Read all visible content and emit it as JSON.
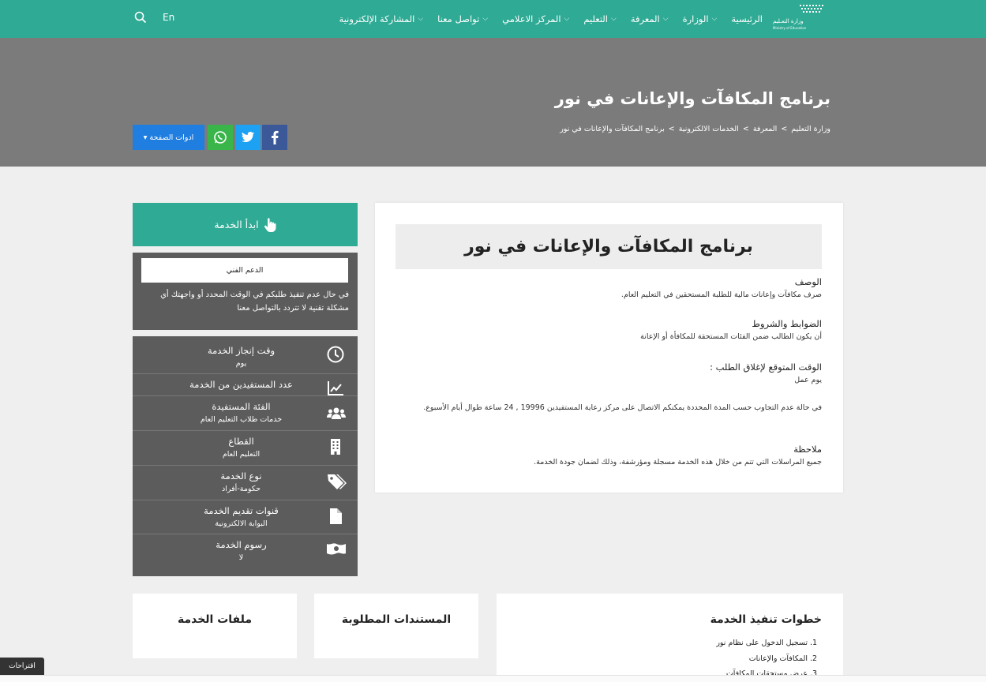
{
  "nav": {
    "menu": [
      {
        "label": "الرئيسية",
        "chevron": false
      },
      {
        "label": "الوزارة",
        "chevron": true
      },
      {
        "label": "المعرفة",
        "chevron": true
      },
      {
        "label": "التعليم",
        "chevron": true
      },
      {
        "label": "المركز الاعلامي",
        "chevron": true
      },
      {
        "label": "تواصل معنا",
        "chevron": true
      },
      {
        "label": "المشاركة الإلكترونية",
        "chevron": true
      }
    ],
    "lang_label": "En",
    "logo_text": "وزارة التعـليم",
    "logo_subtext": "Ministry of Education",
    "chevron_glyph": "⌵"
  },
  "hero": {
    "title": "برنامج المكافآت والإعانات في نور",
    "breadcrumb": [
      "وزارة التعليم",
      "المعرفة",
      "الخدمات الالكترونية",
      "برنامج المكافآت والإعانات في نور"
    ],
    "breadcrumb_sep": ">",
    "tools_label": "ادوات الصفحة",
    "tools_caret": "▾"
  },
  "sidebar": {
    "start_label": "ابدأ الخدمة",
    "support": {
      "button_label": "الدعم الفني",
      "text": "في حال عدم تنفيذ طلبكم في الوقت المحدد أو واجهتك أي مشكلة تقنية لا تتردد بالتواصل معنا"
    },
    "info": [
      {
        "label": "وقت إنجاز الخدمة",
        "value": "يوم",
        "icon": "clock-icon"
      },
      {
        "label": "عدد المستفيدين من الخدمة",
        "value": "",
        "icon": "chart-icon"
      },
      {
        "label": "الفئة المستفيدة",
        "value": "خدمات طلاب التعليم العام",
        "icon": "users-icon"
      },
      {
        "label": "القطاع",
        "value": "التعليم العام",
        "icon": "building-icon"
      },
      {
        "label": "نوع الخدمة",
        "value": "حكومة-أفراد",
        "icon": "tags-icon"
      },
      {
        "label": "قنوات تقديم الخدمة",
        "value": "البوابة الالكترونية",
        "icon": "file-icon"
      },
      {
        "label": "رسوم الخدمة",
        "value": "لا",
        "icon": "money-icon"
      }
    ]
  },
  "content": {
    "title": "برنامج المكافآت والإعانات في نور",
    "sections": [
      {
        "heading": "الوصف",
        "body": "صرف مكافآت وإعانات مالية للطلبة المستحقين في التعليم العام."
      },
      {
        "heading": "الضوابط والشروط",
        "body": "أن يكون الطالب ضمن الفئات المستحقة للمكافأة أو الإعانة"
      },
      {
        "heading": "الوقت المتوقع لإغلاق الطلب :",
        "body": "يوم عمل"
      },
      {
        "heading": "",
        "body": "في حالة عدم التجاوب حسب المدة المحددة يمكنكم الاتصال على مركز رعاية المستفيدين 19996 , 24 ساعة طوال أيام الأسبوع."
      },
      {
        "heading": "ملاحظة",
        "body": "جميع المراسلات التي تتم من خلال هذه الخدمة مسجلة ومؤرشفة، وذلك لضمان جودة الخدمة."
      }
    ]
  },
  "bottom": {
    "steps_title": "خطوات تنفيذ الخدمة",
    "steps": [
      "تسجيل الدخول على نظام نور",
      "المكافآت والإعانات",
      "عرض مستحقات المكافآت"
    ],
    "documents_title": "المستندات المطلوبة",
    "files_title": "ملفات الخدمة"
  },
  "suggestions_label": "اقتراحات",
  "colors": {
    "brand": "#2faa94",
    "hero": "#7b7b7b",
    "sidebar": "#5c5c5c",
    "tools": "#1f7ee0"
  }
}
